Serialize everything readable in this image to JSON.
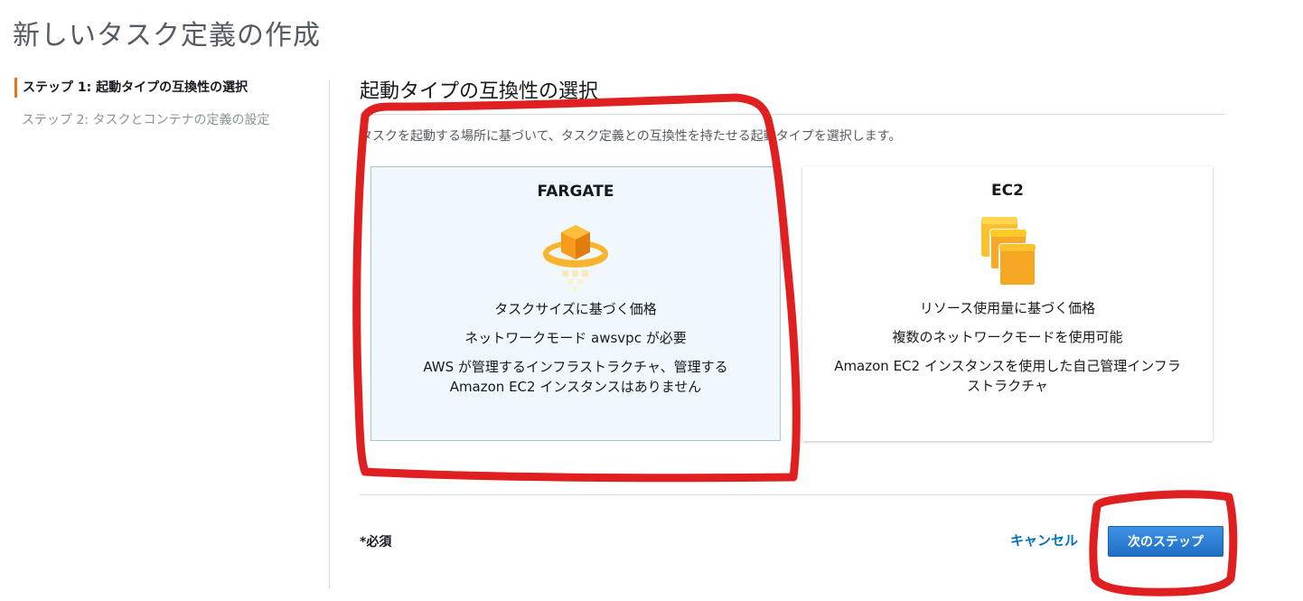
{
  "page": {
    "title": "新しいタスク定義の作成"
  },
  "steps": [
    {
      "label": "ステップ 1: 起動タイプの互換性の選択",
      "active": true
    },
    {
      "label": "ステップ 2: タスクとコンテナの定義の設定",
      "active": false
    }
  ],
  "main": {
    "section_title": "起動タイプの互換性の選択",
    "description": "タスクを起動する場所に基づいて、タスク定義との互換性を持たせる起動タイプを選択します。"
  },
  "cards": {
    "fargate": {
      "title": "FARGATE",
      "icon": "fargate-cube-icon",
      "selected": true,
      "lines": [
        "タスクサイズに基づく価格",
        "ネットワークモード awsvpc が必要",
        "AWS が管理するインフラストラクチャ、管理する Amazon EC2 インスタンスはありません"
      ]
    },
    "ec2": {
      "title": "EC2",
      "icon": "ec2-instances-icon",
      "selected": false,
      "lines": [
        "リソース使用量に基づく価格",
        "複数のネットワークモードを使用可能",
        "Amazon EC2 インスタンスを使用した自己管理インフラストラクチャ"
      ]
    }
  },
  "footer": {
    "required_note": "*必須",
    "cancel_label": "キャンセル",
    "next_label": "次のステップ"
  },
  "colors": {
    "accent_orange": "#ec7211",
    "link_blue": "#0073bb",
    "primary_button": "#2a7fd8",
    "selected_card_bg": "#f1f8fd",
    "annotation_red": "#e02020"
  }
}
